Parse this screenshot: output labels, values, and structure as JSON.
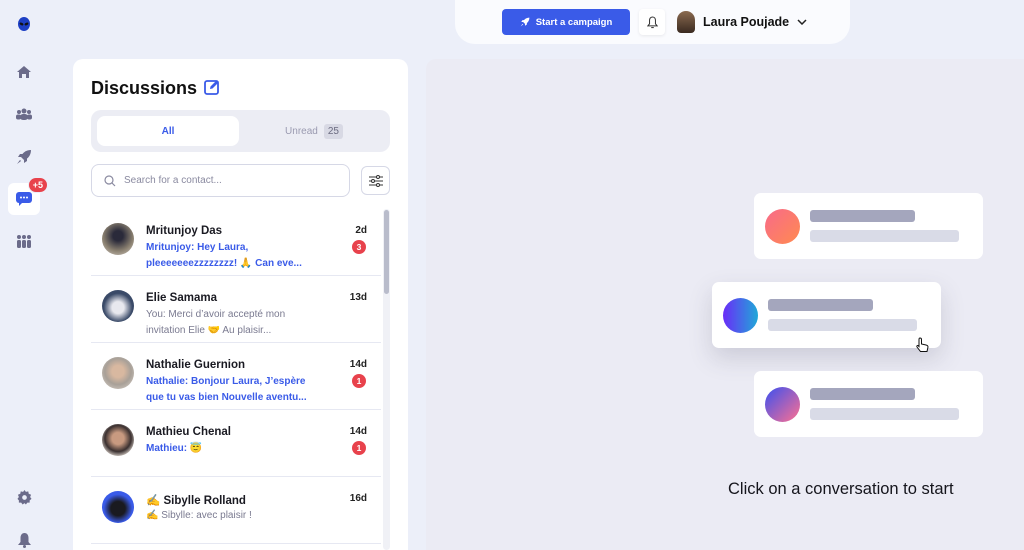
{
  "sidebar": {
    "items": [
      {
        "name": "logo",
        "icon": "alien-logo-icon"
      },
      {
        "name": "home",
        "icon": "home-icon"
      },
      {
        "name": "contacts",
        "icon": "users-icon"
      },
      {
        "name": "campaigns",
        "icon": "rocket-icon"
      },
      {
        "name": "messages",
        "icon": "chat-icon",
        "badge": "+5",
        "active": true
      },
      {
        "name": "team",
        "icon": "team-icon"
      },
      {
        "name": "settings",
        "icon": "gear-icon"
      },
      {
        "name": "notifications",
        "icon": "bell-icon"
      }
    ]
  },
  "topbar": {
    "campaign_button": "Start a campaign",
    "user_name": "Laura Poujade"
  },
  "discussions": {
    "title": "Discussions",
    "tabs": {
      "all": "All",
      "unread": "Unread",
      "unread_count": "25"
    },
    "search_placeholder": "Search for a contact...",
    "items": [
      {
        "name": "Mritunjoy Das",
        "message": "Mritunjoy: Hey Laura, pleeeeeeezzzzzzzz! 🙏 Can eve...",
        "time": "2d",
        "unread": "3"
      },
      {
        "name": "Elie Samama",
        "message": "You: Merci d’avoir accepté mon invitation Elie 🤝 Au plaisir...",
        "time": "13d",
        "unread": null
      },
      {
        "name": "Nathalie Guernion",
        "message": "Nathalie: Bonjour Laura, J’espère que tu vas bien Nouvelle aventu...",
        "time": "14d",
        "unread": "1"
      },
      {
        "name": "Mathieu Chenal",
        "message": "Mathieu: 😇",
        "time": "14d",
        "unread": "1"
      },
      {
        "name": "✍️ Sibylle Rolland",
        "message": "✍️ Sibylle: avec plaisir !",
        "time": "16d",
        "unread": null
      }
    ]
  },
  "main": {
    "empty_state_text": "Click on a conversation to start"
  },
  "colors": {
    "accent": "#3a5be8",
    "badge": "#e8424c",
    "background": "#eceff9"
  }
}
